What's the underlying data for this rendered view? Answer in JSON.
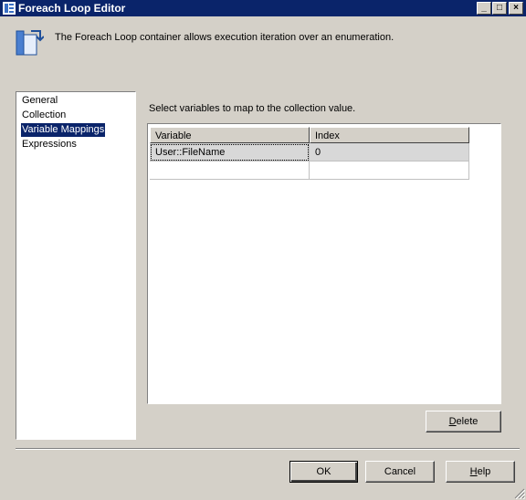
{
  "window": {
    "title": "Foreach Loop Editor",
    "minimize_glyph": "_",
    "maximize_glyph": "□",
    "close_glyph": "×"
  },
  "header": {
    "description": "The Foreach Loop container allows execution iteration over an enumeration.",
    "icon": "foreach-loop-icon"
  },
  "nav": {
    "items": [
      {
        "label": "General",
        "selected": false
      },
      {
        "label": "Collection",
        "selected": false
      },
      {
        "label": "Variable Mappings",
        "selected": true
      },
      {
        "label": "Expressions",
        "selected": false
      }
    ]
  },
  "mappings": {
    "instruction": "Select variables to map to the collection value.",
    "columns": [
      "Variable",
      "Index"
    ],
    "rows": [
      {
        "variable": "User::FileName",
        "index": "0"
      },
      {
        "variable": "",
        "index": ""
      }
    ]
  },
  "buttons": {
    "delete_mnemonic": "D",
    "delete_rest": "elete",
    "ok": "OK",
    "cancel": "Cancel",
    "help_mnemonic": "H",
    "help_rest": "elp"
  },
  "colors": {
    "titlebar": "#0a246a",
    "selection": "#0a246a",
    "face": "#d4d0c8"
  }
}
